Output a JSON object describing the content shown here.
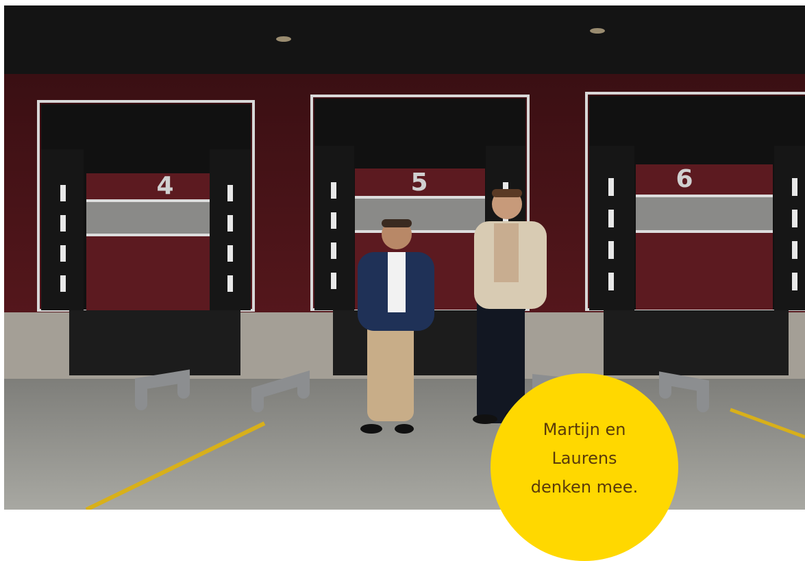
{
  "photo": {
    "dock_numbers": [
      "4",
      "5",
      "6"
    ],
    "colors": {
      "ceiling": "#141414",
      "wall": "#4a1419",
      "door": "#5a1a20",
      "ground": "#9a9a94",
      "badge": "#ffd800",
      "badge_text": "#5a3a0a",
      "line": "#d8b01a"
    }
  },
  "badge": {
    "lines": [
      "Martijn en",
      "Laurens",
      "denken mee."
    ]
  }
}
